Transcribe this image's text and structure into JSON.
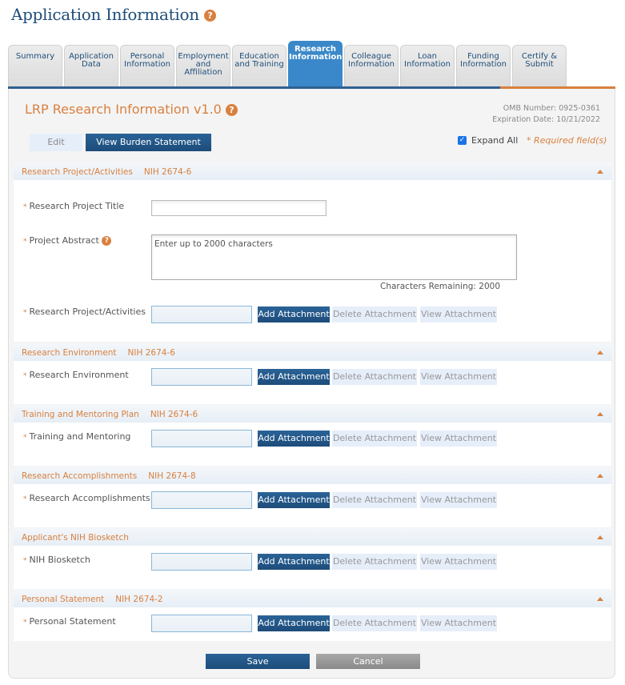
{
  "page": {
    "title": "Application Information",
    "help_icon": "?"
  },
  "tabs": [
    {
      "label": "Summary",
      "active": false
    },
    {
      "label": "Application Data",
      "active": false
    },
    {
      "label": "Personal Information",
      "active": false
    },
    {
      "label": "Employment and Affiliation",
      "active": false
    },
    {
      "label": "Education and Training",
      "active": false
    },
    {
      "label": "Research Information",
      "active": true
    },
    {
      "label": "Colleague Information",
      "active": false
    },
    {
      "label": "Loan Information",
      "active": false
    },
    {
      "label": "Funding Information",
      "active": false
    },
    {
      "label": "Certify & Submit",
      "active": false
    }
  ],
  "form": {
    "title": "LRP Research Information v1.0",
    "omb_number": "OMB Number: 0925-0361",
    "expiration": "Expiration Date: 10/21/2022",
    "edit_label": "Edit",
    "burden_label": "View Burden Statement",
    "expand_all_label": "Expand All",
    "expand_all_checked": true,
    "required_note": "* Required field(s)"
  },
  "sections": [
    {
      "title": "Research Project/Activities",
      "code": "NIH 2674-6",
      "fields": {
        "title_label": "Research Project Title",
        "title_value": "",
        "abstract_label": "Project Abstract",
        "abstract_placeholder": "Enter up to 2000 characters",
        "chars_remaining": "Characters Remaining: 2000",
        "attachment_label": "Research Project/Activities"
      }
    },
    {
      "title": "Research Environment",
      "code": "NIH 2674-6",
      "attachment_label": "Research Environment"
    },
    {
      "title": "Training and Mentoring Plan",
      "code": "NIH 2674-6",
      "attachment_label": "Training and Mentoring"
    },
    {
      "title": "Research Accomplishments",
      "code": "NIH 2674-8",
      "attachment_label": "Research Accomplishments"
    },
    {
      "title": "Applicant's NIH Biosketch",
      "code": "",
      "attachment_label": "NIH Biosketch"
    },
    {
      "title": "Personal Statement",
      "code": "NIH 2674-2",
      "attachment_label": "Personal Statement"
    }
  ],
  "attachment_buttons": {
    "add": "Add Attachment",
    "delete": "Delete Attachment",
    "view": "View Attachment"
  },
  "required_marker": "*",
  "footer": {
    "save": "Save",
    "cancel": "Cancel"
  }
}
